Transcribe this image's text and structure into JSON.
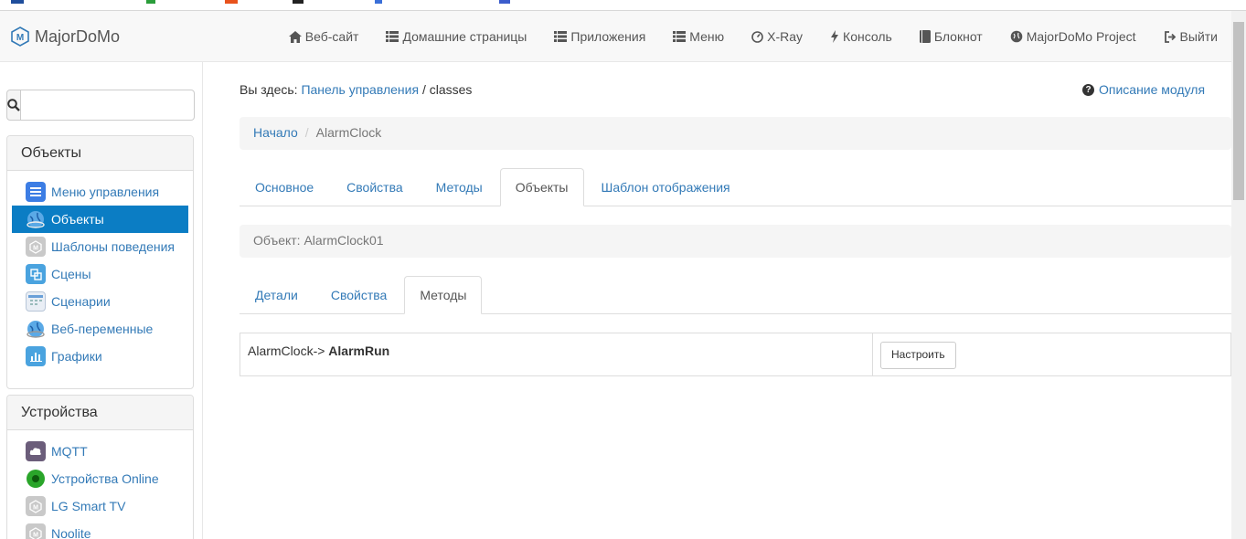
{
  "app": {
    "name": "MajorDoMo"
  },
  "navbar": {
    "items": [
      {
        "label": "Веб-сайт",
        "icon": "home-icon"
      },
      {
        "label": "Домашние страницы",
        "icon": "list-icon"
      },
      {
        "label": "Приложения",
        "icon": "list-icon"
      },
      {
        "label": "Меню",
        "icon": "list-icon"
      },
      {
        "label": "X-Ray",
        "icon": "dashboard-icon"
      },
      {
        "label": "Консоль",
        "icon": "flash-icon"
      },
      {
        "label": "Блокнот",
        "icon": "book-icon"
      },
      {
        "label": "MajorDoMo Project",
        "icon": "globe-icon"
      },
      {
        "label": "Выйти",
        "icon": "logout-icon"
      }
    ]
  },
  "sidebar": {
    "search": {
      "value": "",
      "placeholder": ""
    },
    "objects_panel": {
      "title": "Объекты",
      "items": [
        {
          "label": "Меню управления",
          "icon": "menu-icon",
          "active": false
        },
        {
          "label": "Объекты",
          "icon": "globe-icon",
          "active": true
        },
        {
          "label": "Шаблоны поведения",
          "icon": "majordomo-icon",
          "active": false
        },
        {
          "label": "Сцены",
          "icon": "scenes-icon",
          "active": false
        },
        {
          "label": "Сценарии",
          "icon": "calendar-icon",
          "active": false
        },
        {
          "label": "Веб-переменные",
          "icon": "globe-icon",
          "active": false
        },
        {
          "label": "Графики",
          "icon": "chart-icon",
          "active": false
        }
      ]
    },
    "devices_panel": {
      "title": "Устройства",
      "items": [
        {
          "label": "MQTT",
          "icon": "mqtt-icon"
        },
        {
          "label": "Устройства Online",
          "icon": "online-icon"
        },
        {
          "label": "LG Smart TV",
          "icon": "majordomo-icon"
        },
        {
          "label": "Noolite",
          "icon": "majordomo-icon"
        }
      ]
    }
  },
  "main": {
    "location_prefix": "Вы здесь:",
    "location_link": "Панель управления",
    "location_sep": "/",
    "location_current": "classes",
    "help_link": "Описание модуля",
    "breadcrumb": {
      "home": "Начало",
      "sep": "/",
      "current": "AlarmClock"
    },
    "class_tabs": [
      {
        "label": "Основное",
        "active": false
      },
      {
        "label": "Свойства",
        "active": false
      },
      {
        "label": "Методы",
        "active": false
      },
      {
        "label": "Объекты",
        "active": true
      },
      {
        "label": "Шаблон отображения",
        "active": false
      }
    ],
    "object_title": "Объект: AlarmClock01",
    "object_tabs": [
      {
        "label": "Детали",
        "active": false
      },
      {
        "label": "Свойства",
        "active": false
      },
      {
        "label": "Методы",
        "active": true
      }
    ],
    "methods": [
      {
        "prefix": "AlarmClock->",
        "name": "AlarmRun",
        "button": "Настроить"
      }
    ]
  },
  "colors": {
    "accent": "#337ab7",
    "active_nav": "#0b7dc4",
    "panel_bg": "#f5f5f5"
  }
}
